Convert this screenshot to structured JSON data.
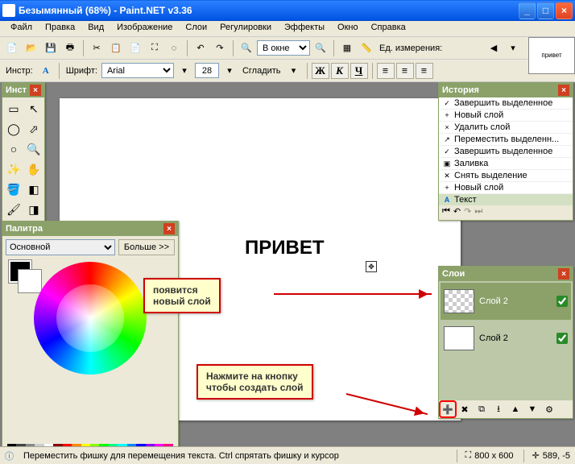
{
  "window": {
    "title": "Безымянный (68%) - Paint.NET v3.36",
    "min": "_",
    "max": "□",
    "close": "×"
  },
  "menu": {
    "items": [
      "Файл",
      "Правка",
      "Вид",
      "Изображение",
      "Слои",
      "Регулировки",
      "Эффекты",
      "Окно",
      "Справка"
    ]
  },
  "toolbar1": {
    "zoom_label": "В окне",
    "units_label": "Ед. измерения:"
  },
  "toolbar2": {
    "instr_label": "Инстр:",
    "font_label": "Шрифт:",
    "font_value": "Arial",
    "size_value": "28",
    "smooth_label": "Сгладить"
  },
  "canvas": {
    "text": "ПРИВЕТ"
  },
  "tools_panel": {
    "title": "Инст"
  },
  "palette_panel": {
    "title": "Палитра",
    "mode": "Основной",
    "more": "Больше >>"
  },
  "history_panel": {
    "title": "История",
    "items": [
      {
        "icon": "✓",
        "label": "Завершить выделенное"
      },
      {
        "icon": "+",
        "label": "Новый слой"
      },
      {
        "icon": "×",
        "label": "Удалить слой"
      },
      {
        "icon": "↗",
        "label": "Переместить выделенн..."
      },
      {
        "icon": "✓",
        "label": "Завершить выделенное"
      },
      {
        "icon": "▣",
        "label": "Заливка"
      },
      {
        "icon": "✕",
        "label": "Снять выделение"
      },
      {
        "icon": "+",
        "label": "Новый слой"
      },
      {
        "icon": "A",
        "label": "Текст"
      }
    ]
  },
  "layers_panel": {
    "title": "Слои",
    "layers": [
      {
        "name": "Слой 2",
        "checker": true,
        "selected": true,
        "visible": true
      },
      {
        "name": "Слой 2",
        "checker": false,
        "selected": false,
        "visible": true
      }
    ]
  },
  "callouts": {
    "c1": "появится\nновый слой",
    "c2": "Нажмите на кнопку\nчтобы создать слой"
  },
  "statusbar": {
    "hint": "Переместить фишку для перемещения текста. Ctrl спрятать фишку и курсор",
    "size": "800 x 600",
    "pos": "589, -5"
  },
  "thumb": "привет"
}
